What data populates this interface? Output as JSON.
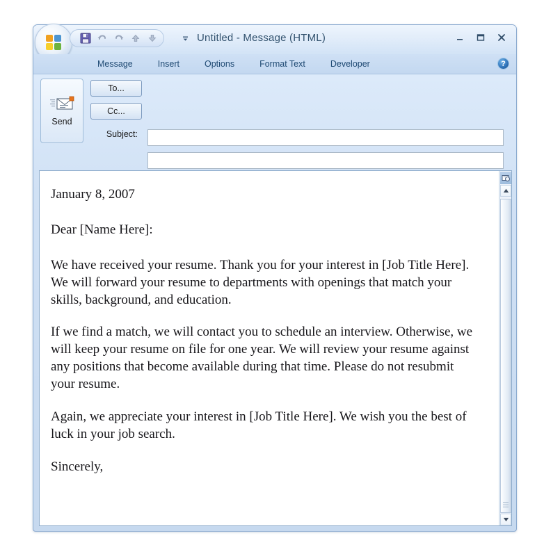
{
  "window": {
    "title": "Untitled - Message (HTML)",
    "office_button": "office-orb",
    "minimize_label": "–",
    "maximize_label": "❐",
    "close_label": "✕"
  },
  "quick_access": {
    "items": [
      {
        "name": "save-icon",
        "glyph": "■"
      },
      {
        "name": "undo-icon",
        "glyph": "↶"
      },
      {
        "name": "redo-icon",
        "glyph": "↷"
      },
      {
        "name": "previous-item-icon",
        "glyph": "▲"
      },
      {
        "name": "next-item-icon",
        "glyph": "▼"
      }
    ],
    "dropdown_glyph": "▼"
  },
  "ribbon": {
    "tabs": [
      {
        "label": "Message"
      },
      {
        "label": "Insert"
      },
      {
        "label": "Options"
      },
      {
        "label": "Format Text"
      },
      {
        "label": "Developer"
      }
    ],
    "help_glyph": "?"
  },
  "header": {
    "send_label": "Send",
    "to_label": "To...",
    "cc_label": "Cc...",
    "subject_label": "Subject:",
    "to_value": "",
    "cc_value": "",
    "subject_value": ""
  },
  "body": {
    "date": "January 8, 2007",
    "salutation": "Dear [Name Here]:",
    "paragraph_1": "We have received your resume. Thank you for your interest in [Job Title Here]. We will forward your resume to departments with openings that match your skills, background, and education.",
    "paragraph_2": "If we find a match, we will contact you to schedule an interview. Otherwise, we will keep your resume on file for one year. We will review your resume against any positions that become available during that time. Please do not resubmit your resume.",
    "paragraph_3": "Again, we appreciate your interest in [Job Title Here]. We wish you the best of luck in your job search.",
    "closing": "Sincerely,"
  },
  "scrollbar": {
    "up_glyph": "▲",
    "down_glyph": "▼"
  },
  "colors": {
    "title_text": "#33536f",
    "tab_text": "#1f4a73",
    "window_border": "#8aaad0",
    "orb_orange": "#f0a020",
    "orb_blue": "#4e95d0",
    "orb_yellow": "#f6cf2a",
    "orb_green": "#6cb33f"
  }
}
